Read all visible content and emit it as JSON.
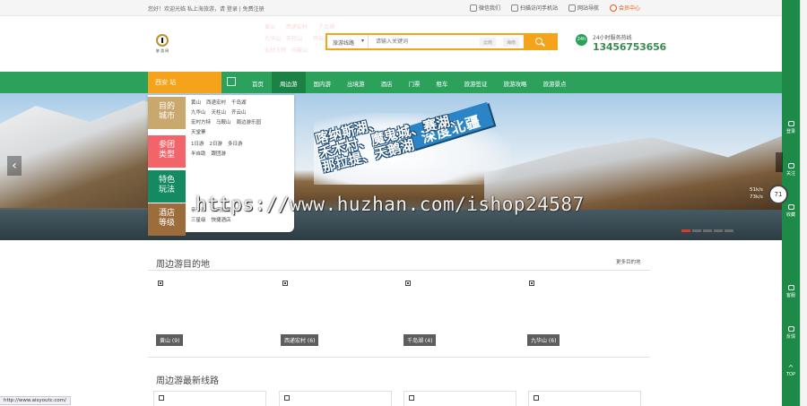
{
  "topbar": {
    "welcome": "您好！欢迎光临 私上海旅游，请 登录 | 免费注册",
    "links": [
      "微信我们",
      "扫描访问手机站",
      "网站导航",
      "会员中心"
    ]
  },
  "logo": {
    "text": "旅 游 网"
  },
  "search": {
    "select": "旅游线路",
    "placeholder": "请输入关键词",
    "tags": [
      "云南",
      "海南"
    ]
  },
  "hotline": {
    "label": "24小时服务热线",
    "number": "13456753656",
    "icon_text": "24h"
  },
  "nav": {
    "city": "西安 站",
    "items": [
      "首页",
      "周边游",
      "国内游",
      "出境游",
      "酒店",
      "门票",
      "租车",
      "旅游签证",
      "旅游攻略",
      "旅游景点"
    ],
    "active_index": 1
  },
  "banner": {
    "slogan": "深度北疆",
    "promo_line1": "喀纳斯湖、",
    "promo_line2": "禾木村、魔鬼城、赛湖、",
    "promo_line3": "那拉提、天鹅湖"
  },
  "menu": {
    "cats": [
      "目的\n城市",
      "参团\n类型",
      "特色\n玩法",
      "酒店\n等级"
    ],
    "row1": [
      "黄山",
      "西递宏村",
      "千岛湖"
    ],
    "row2": [
      "九华山",
      "天柱山",
      "齐云山"
    ],
    "row3": [
      "宏村方特",
      "马鞍山",
      "周边游乐园"
    ],
    "row4": [
      "天堂寨"
    ],
    "row5": [
      "1日游",
      "2日游",
      "多日游"
    ],
    "row6": [
      "半自助",
      "跟团游"
    ],
    "row7": [
      "亲子游",
      "休闲度假"
    ],
    "row8": [
      "三星级",
      "快捷酒店"
    ]
  },
  "watermark": "https://www.huzhan.com/ishop24587",
  "sections": {
    "destinations_title": "周边游目的地",
    "more": "更多目的地",
    "routes_title": "周边游最新线路"
  },
  "destinations": [
    {
      "label": "黄山 (9)"
    },
    {
      "label": "西递宏村 (6)"
    },
    {
      "label": "千岛湖 (4)"
    },
    {
      "label": "九华山 (6)"
    }
  ],
  "status_url": "http://www.aisyoutc.com/",
  "sidebar": [
    "登录",
    "关注",
    "收藏",
    "客服",
    "反馈",
    "TOP"
  ],
  "float": {
    "value": "71",
    "badge": "51k/s",
    "badge2": "73k/s"
  }
}
